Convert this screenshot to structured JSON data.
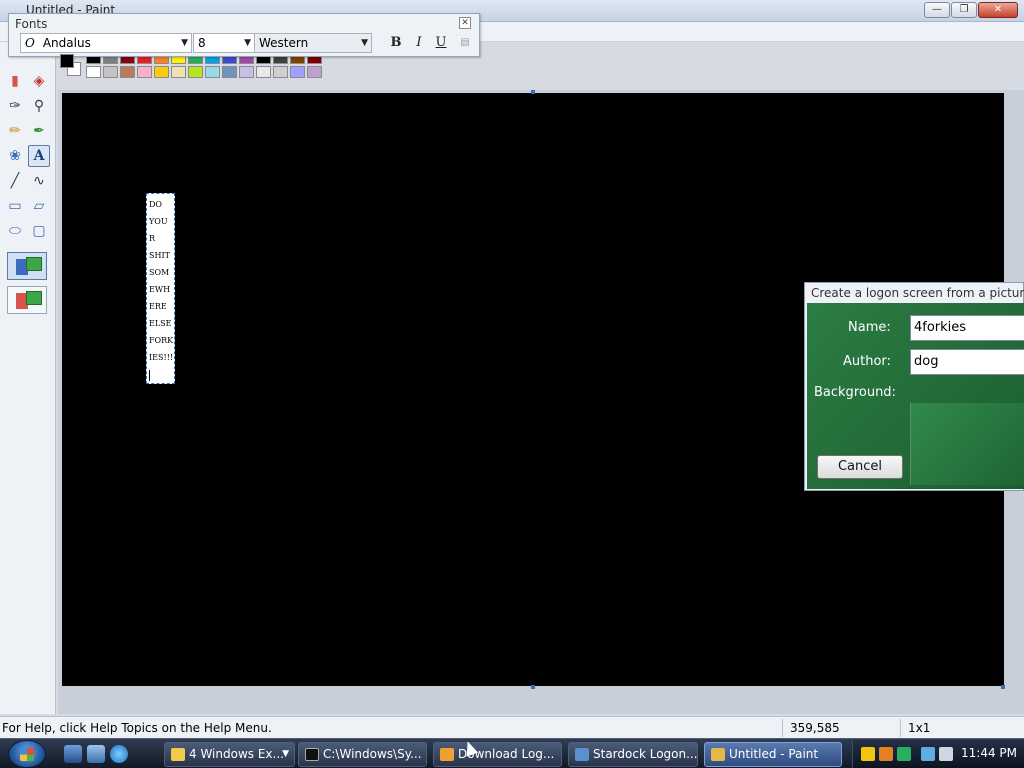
{
  "window": {
    "title": "Untitled - Paint"
  },
  "fonts_toolbar": {
    "title": "Fonts",
    "font_name": "Andalus",
    "font_size": "8",
    "script": "Western",
    "bold_label": "B",
    "italic_label": "I",
    "underline_label": "U"
  },
  "palette": {
    "foreground": "#000000",
    "background": "#ffffff",
    "colors_row1": [
      "#000000",
      "#7f7f7f",
      "#880015",
      "#ed1c24",
      "#ff7f27",
      "#fff200",
      "#22b14c",
      "#00a2e8",
      "#3f48cc",
      "#a349a4",
      "#000000",
      "#404040",
      "#804000",
      "#7f0000"
    ],
    "colors_row2": [
      "#ffffff",
      "#c3c3c3",
      "#b97a57",
      "#ffaec9",
      "#ffc90e",
      "#efe4b0",
      "#b5e61d",
      "#99d9ea",
      "#7092be",
      "#c8bfe7",
      "#e8e8e8",
      "#d0d0d0",
      "#a0a0ff",
      "#c0a0d0"
    ]
  },
  "canvas": {
    "background": "#000000",
    "text_lines": [
      "DO",
      "YOU",
      "R",
      "SHIT",
      "SOM",
      "EWH",
      "ERE",
      "ELSE",
      "FORK",
      "IES!!!!"
    ]
  },
  "logon_dialog": {
    "title": "Create a logon screen from a picture",
    "name_label": "Name:",
    "name_value": "4forkies",
    "author_label": "Author:",
    "author_value": "dog",
    "background_label": "Background:",
    "cancel_label": "Cancel"
  },
  "statusbar": {
    "help_text": "For Help, click Help Topics on the Help Menu.",
    "coordinates": "359,585",
    "selection_size": "1x1"
  },
  "taskbar": {
    "tasks": [
      {
        "label": "4 Windows Ex..."
      },
      {
        "label": "C:\\Windows\\Sy..."
      },
      {
        "label": "Download Log..."
      },
      {
        "label": "Stardock Logon..."
      },
      {
        "label": "Untitled - Paint"
      }
    ],
    "clock": "11:44 PM"
  }
}
